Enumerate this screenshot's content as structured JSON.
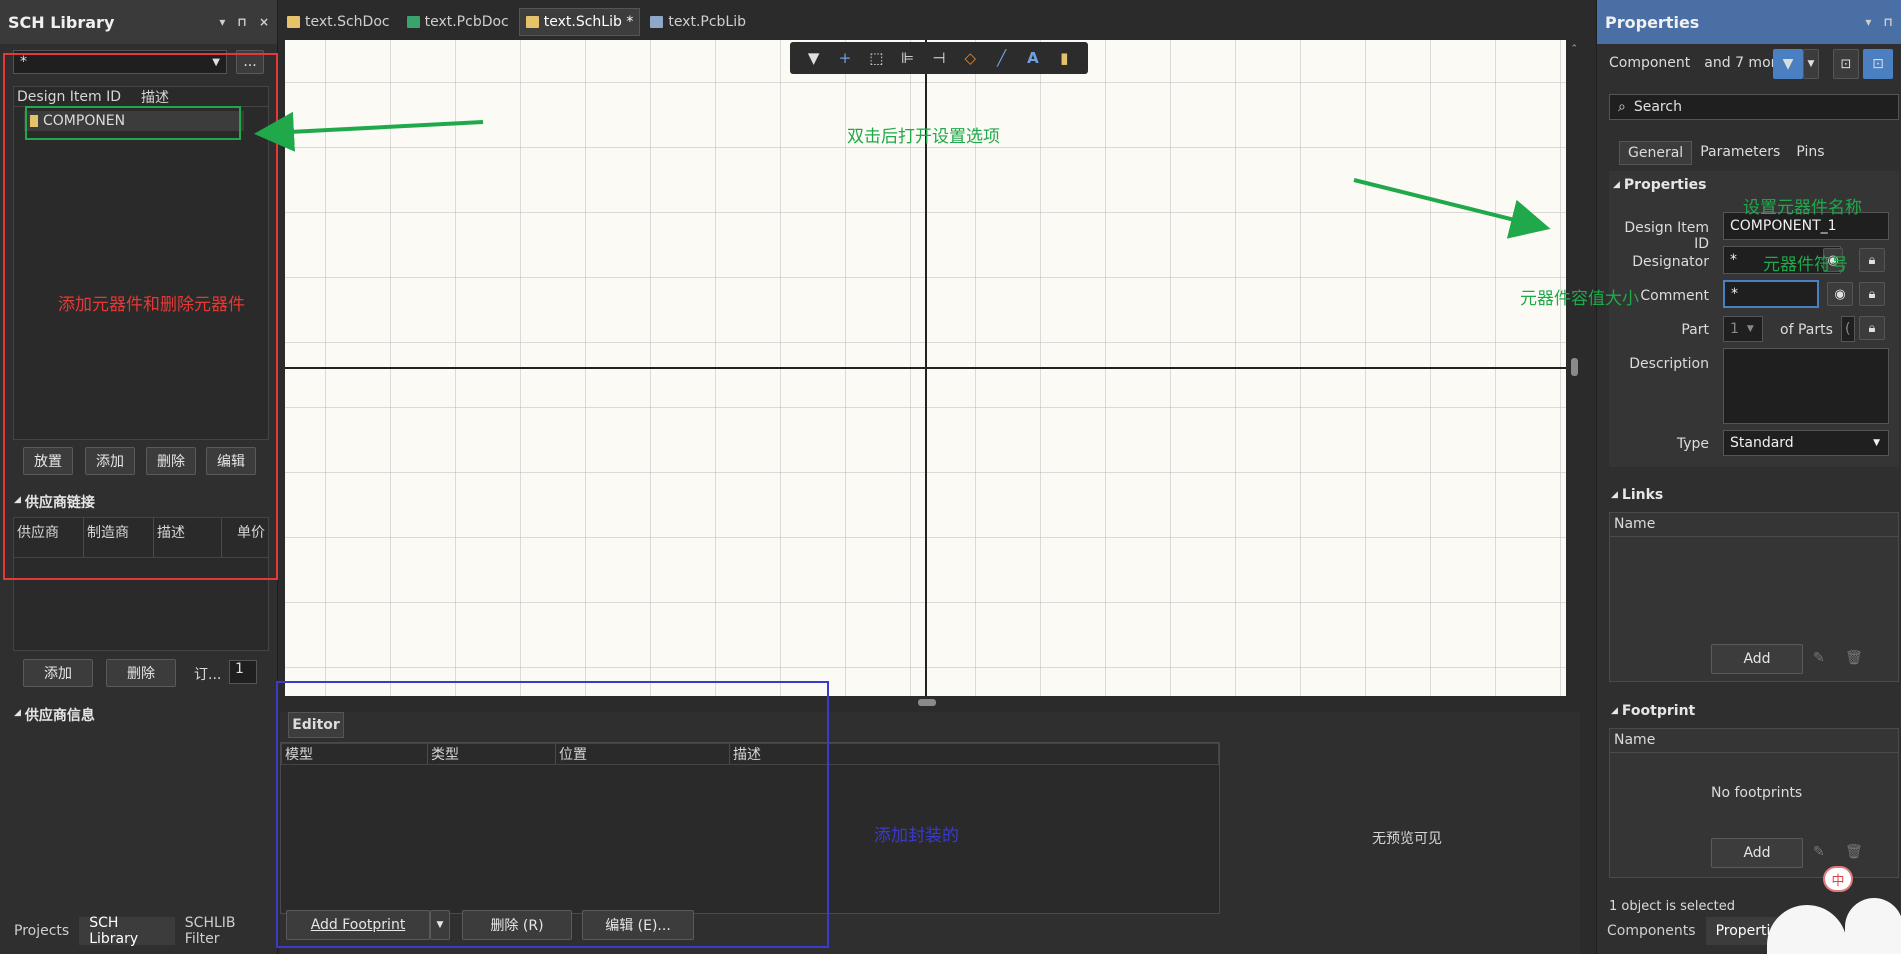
{
  "left_panel": {
    "title": "SCH Library",
    "header_icons": [
      "▾",
      "⊓",
      "×"
    ],
    "filter_value": "*",
    "filter_btn": "...",
    "components_header": {
      "col1": "Design Item ID",
      "col2": "描述"
    },
    "components": [
      {
        "name": "COMPONEN"
      }
    ],
    "buttons": {
      "place": "放置",
      "add": "添加",
      "delete": "删除",
      "edit": "编辑"
    },
    "supplier_links": {
      "title": "供应商链接",
      "columns": [
        "供应商",
        "制造商",
        "描述",
        "单价"
      ],
      "add": "添加",
      "delete": "删除",
      "order_label": "订...",
      "order_value": "1"
    },
    "supplier_info_title": "供应商信息",
    "bottom_tabs": [
      "Projects",
      "SCH Library",
      "SCHLIB Filter"
    ]
  },
  "doc_tabs": [
    {
      "label": "text.SchDoc",
      "color": "#e6c36a"
    },
    {
      "label": "text.PcbDoc",
      "color": "#3aa36b"
    },
    {
      "label": "text.SchLib *",
      "color": "#e6c36a"
    },
    {
      "label": "text.PcbLib",
      "color": "#8fa8c8"
    }
  ],
  "toolbar_icons": [
    "filter-icon",
    "cross-icon",
    "select-rect-icon",
    "align-icon",
    "pin-icon",
    "eraser-icon",
    "line-icon",
    "text-icon",
    "part-icon"
  ],
  "toolbar_glyphs": [
    "▼",
    "+",
    "⬚",
    "⊫",
    "⊣",
    "◇",
    "╱",
    "A",
    "▮"
  ],
  "editor": {
    "tab": "Editor",
    "columns": [
      "模型",
      "类型",
      "位置",
      "描述"
    ],
    "no_preview": "无预览可见",
    "add_footprint": "Add Footprint",
    "delete_btn": "删除 (R)",
    "edit_btn": "编辑 (E)..."
  },
  "right_panel": {
    "title": "Properties",
    "header_icons": [
      "▾",
      "⊓"
    ],
    "component_filter": "Component",
    "more": "and 7 more)",
    "search_placeholder": "Search",
    "tabs": [
      "General",
      "Parameters",
      "Pins"
    ],
    "properties_title": "Properties",
    "design_item_id_label": "Design Item ID",
    "design_item_id_value": "COMPONENT_1",
    "designator_label": "Designator",
    "designator_value": "*",
    "comment_label": "Comment",
    "comment_value": "*",
    "part_label": "Part",
    "part_value": "1",
    "of_parts_label": "of Parts",
    "of_parts_value": "(",
    "description_label": "Description",
    "type_label": "Type",
    "type_value": "Standard",
    "links_title": "Links",
    "links_name_col": "Name",
    "links_add": "Add",
    "footprint_title": "Footprint",
    "footprint_name_col": "Name",
    "no_footprints": "No footprints",
    "footprint_add": "Add",
    "selection_status": "1 object is selected",
    "bottom_tabs": [
      "Components",
      "Properties"
    ],
    "mascot_badge": "中"
  },
  "annotations": {
    "canvas_hint": "双击后打开设置选项",
    "left_hint": "添加元器件和删除元器件",
    "set_name": "设置元器件名称",
    "symbol_hint": "元器件符号",
    "value_hint": "元器件容值大小",
    "footprint_hint": "添加封装的"
  },
  "colors": {
    "annotation_green": "#1fa94a",
    "annotation_red": "#e53935",
    "annotation_blue": "#3a3acc",
    "accent_blue": "#4a7fc1",
    "canvas_bg": "#fcfaf4"
  }
}
